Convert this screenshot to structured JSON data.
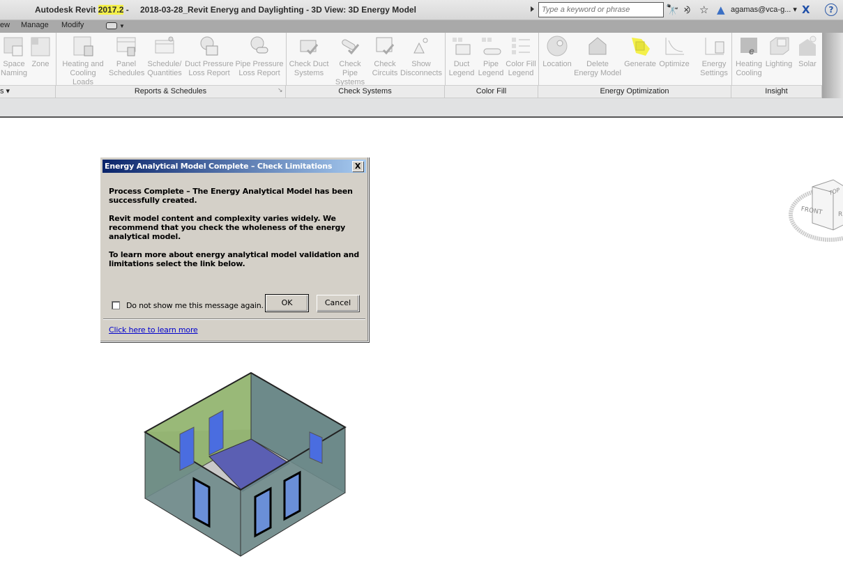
{
  "titlebar": {
    "app_name": "Autodesk Revit ",
    "version": "2017.2",
    "separator": " - ",
    "document_title": "2018-03-28_Revit Eneryg and Daylighting - 3D View: 3D Energy Model",
    "search_placeholder": "Type a keyword or phrase",
    "user": "agamas@vca-g...",
    "icons": [
      "binoculars-icon",
      "satellite-icon",
      "star-icon",
      "user-icon",
      "exchange-icon",
      "help-icon"
    ]
  },
  "tabs": [
    {
      "label": "ew"
    },
    {
      "label": "Manage"
    },
    {
      "label": "Modify"
    }
  ],
  "ribbon": {
    "buttons": [
      {
        "label1": "Space",
        "label2": "Naming",
        "icon": "space-naming-icon"
      },
      {
        "label1": "Zone",
        "label2": "",
        "icon": "zone-icon"
      },
      {
        "label1": "Heating and",
        "label2": "Cooling Loads",
        "icon": "heating-cooling-loads-icon"
      },
      {
        "label1": "Panel",
        "label2": "Schedules",
        "icon": "panel-schedules-icon"
      },
      {
        "label1": "Schedule/",
        "label2": "Quantities",
        "icon": "schedule-quantities-icon"
      },
      {
        "label1": "Duct Pressure",
        "label2": "Loss Report",
        "icon": "duct-pressure-icon"
      },
      {
        "label1": "Pipe Pressure",
        "label2": "Loss Report",
        "icon": "pipe-pressure-icon"
      },
      {
        "label1": "Check Duct",
        "label2": "Systems",
        "icon": "check-duct-icon"
      },
      {
        "label1": "Check Pipe",
        "label2": "Systems",
        "icon": "check-pipe-icon"
      },
      {
        "label1": "Check",
        "label2": "Circuits",
        "icon": "check-circuits-icon"
      },
      {
        "label1": "Show",
        "label2": "Disconnects",
        "icon": "show-disconnects-icon"
      },
      {
        "label1": "Duct",
        "label2": "Legend",
        "icon": "duct-legend-icon"
      },
      {
        "label1": "Pipe",
        "label2": "Legend",
        "icon": "pipe-legend-icon"
      },
      {
        "label1": "Color Fill",
        "label2": "Legend",
        "icon": "color-fill-legend-icon"
      },
      {
        "label1": "Location",
        "label2": "",
        "icon": "location-icon"
      },
      {
        "label1": "Delete",
        "label2": "Energy Model",
        "icon": "delete-energy-model-icon"
      },
      {
        "label1": "Generate",
        "label2": "",
        "icon": "generate-icon"
      },
      {
        "label1": "Optimize",
        "label2": "",
        "icon": "optimize-icon"
      },
      {
        "label1": "Energy",
        "label2": "Settings",
        "icon": "energy-settings-icon"
      },
      {
        "label1": "Heating",
        "label2": "Cooling",
        "icon": "heating-cooling-icon"
      },
      {
        "label1": "Lighting",
        "label2": "",
        "icon": "lighting-icon"
      },
      {
        "label1": "Solar",
        "label2": "",
        "icon": "solar-icon"
      }
    ],
    "panels": [
      {
        "title": "s ▾"
      },
      {
        "title": "Reports & Schedules"
      },
      {
        "title": "Check Systems"
      },
      {
        "title": "Color Fill"
      },
      {
        "title": "Energy Optimization"
      },
      {
        "title": "Insight"
      }
    ]
  },
  "dialog": {
    "title": "Energy Analytical Model Complete – Check Limitations",
    "para1": "Process Complete – The Energy Analytical Model has been successfully created.",
    "para2": "Revit model content and complexity varies widely. We recommend that you check the wholeness of the energy analytical model.",
    "para3": "To learn more about energy analytical model validation and limitations select the link below.",
    "checkbox_label": "Do not show me this message again.",
    "checkbox_checked": false,
    "ok_label": "OK",
    "cancel_label": "Cancel",
    "link_label": "Click here to learn more",
    "close_label": "X"
  },
  "viewcube": {
    "faces": [
      "TOP",
      "FRONT",
      "R"
    ]
  },
  "colors": {
    "highlight": "#f4f04a",
    "dialog_bg": "#d4d0c8",
    "title_gradient_start": "#0a246a",
    "title_gradient_end": "#a6caf0",
    "link": "#0000cc"
  }
}
